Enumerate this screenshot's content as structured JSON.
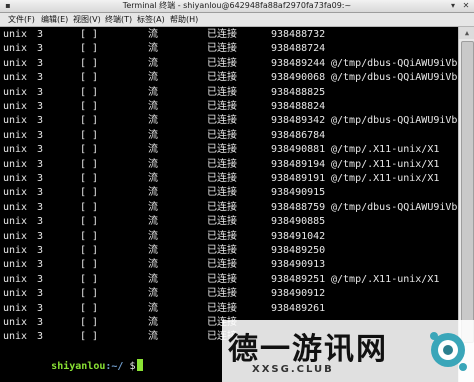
{
  "window": {
    "title": "Terminal 终端 - shiyanlou@642948fa88af2970fa73fa09:~"
  },
  "menu": [
    "文件(F)",
    "编辑(E)",
    "视图(V)",
    "终端(T)",
    "标签(A)",
    "帮助(H)"
  ],
  "rows": [
    [
      "unix",
      "3",
      "[ ]",
      "流",
      "已连接",
      "938488732",
      ""
    ],
    [
      "unix",
      "3",
      "[ ]",
      "流",
      "已连接",
      "938488724",
      ""
    ],
    [
      "unix",
      "3",
      "[ ]",
      "流",
      "已连接",
      "938489244",
      "@/tmp/dbus-QQiAWU9iVb"
    ],
    [
      "unix",
      "3",
      "[ ]",
      "流",
      "已连接",
      "938490068",
      "@/tmp/dbus-QQiAWU9iVb"
    ],
    [
      "unix",
      "3",
      "[ ]",
      "流",
      "已连接",
      "938488825",
      ""
    ],
    [
      "unix",
      "3",
      "[ ]",
      "流",
      "已连接",
      "938488824",
      ""
    ],
    [
      "unix",
      "3",
      "[ ]",
      "流",
      "已连接",
      "938489342",
      "@/tmp/dbus-QQiAWU9iVb"
    ],
    [
      "unix",
      "3",
      "[ ]",
      "流",
      "已连接",
      "938486784",
      ""
    ],
    [
      "unix",
      "3",
      "[ ]",
      "流",
      "已连接",
      "938490881",
      "@/tmp/.X11-unix/X1"
    ],
    [
      "unix",
      "3",
      "[ ]",
      "流",
      "已连接",
      "938489194",
      "@/tmp/.X11-unix/X1"
    ],
    [
      "unix",
      "3",
      "[ ]",
      "流",
      "已连接",
      "938489191",
      "@/tmp/.X11-unix/X1"
    ],
    [
      "unix",
      "3",
      "[ ]",
      "流",
      "已连接",
      "938490915",
      ""
    ],
    [
      "unix",
      "3",
      "[ ]",
      "流",
      "已连接",
      "938488759",
      "@/tmp/dbus-QQiAWU9iVb"
    ],
    [
      "unix",
      "3",
      "[ ]",
      "流",
      "已连接",
      "938490885",
      ""
    ],
    [
      "unix",
      "3",
      "[ ]",
      "流",
      "已连接",
      "938491042",
      ""
    ],
    [
      "unix",
      "3",
      "[ ]",
      "流",
      "已连接",
      "938489250",
      ""
    ],
    [
      "unix",
      "3",
      "[ ]",
      "流",
      "已连接",
      "938490913",
      ""
    ],
    [
      "unix",
      "3",
      "[ ]",
      "流",
      "已连接",
      "938489251",
      "@/tmp/.X11-unix/X1"
    ],
    [
      "unix",
      "3",
      "[ ]",
      "流",
      "已连接",
      "938490912",
      ""
    ],
    [
      "unix",
      "3",
      "[ ]",
      "流",
      "已连接",
      "938489261",
      ""
    ],
    [
      "unix",
      "3",
      "[ ]",
      "流",
      "已连接",
      "",
      ""
    ],
    [
      "unix",
      "3",
      "[ ]",
      "流",
      "已连接",
      "",
      ""
    ]
  ],
  "prompt": {
    "user_host": "shiyanlou",
    "path": ":~/",
    "symbol": "$"
  },
  "watermark": {
    "main": "德一游讯网",
    "sub": "XXSG.CLUB"
  },
  "colors": {
    "prompt_user": "#8ae234",
    "prompt_path": "#729fcf",
    "cursor": "#8ae234"
  }
}
